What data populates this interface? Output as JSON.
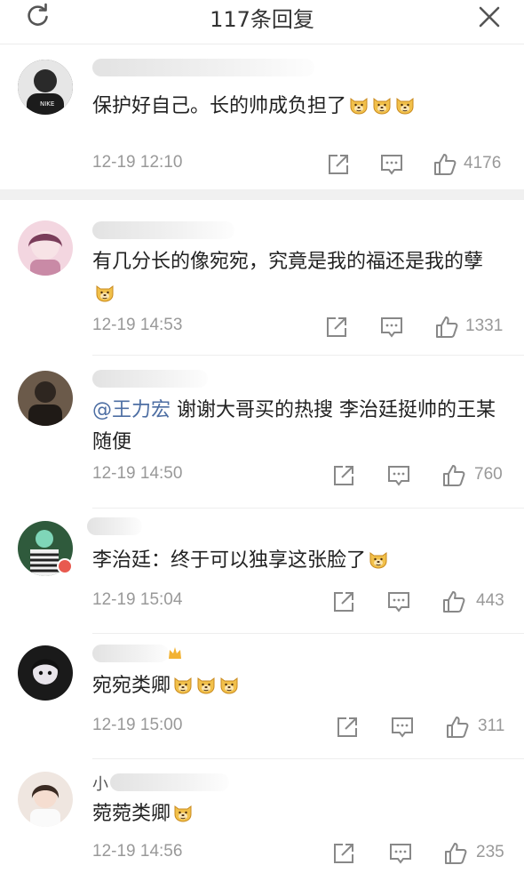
{
  "header": {
    "title": "117条回复",
    "refresh_icon": "refresh-icon",
    "close_icon": "close-icon"
  },
  "comments": [
    {
      "username": "",
      "text": "保护好自己。长的帅成负担了",
      "emoji_count": 3,
      "time": "12-19 12:10",
      "likes": "4176",
      "avatar_color": "#3a3a3a"
    },
    {
      "username": "",
      "text": "有几分长的像宛宛，究竟是我的福还是我的孽",
      "emoji_count": 1,
      "time": "12-19 14:53",
      "likes": "1331",
      "avatar_color": "#e8b9c8"
    },
    {
      "username": "",
      "mention": "@王力宏",
      "text": " 谢谢大哥买的热搜 李治廷挺帅的王某随便",
      "emoji_count": 0,
      "time": "12-19 14:50",
      "likes": "760",
      "avatar_color": "#4a4038"
    },
    {
      "username": "",
      "text": "李治廷：终于可以独享这张脸了",
      "emoji_count": 1,
      "time": "12-19 15:04",
      "likes": "443",
      "avatar_color": "#3a6a48"
    },
    {
      "username": "",
      "text": "宛宛类卿",
      "emoji_count": 3,
      "time": "12-19 15:00",
      "likes": "311",
      "avatar_color": "#2a2a2a"
    },
    {
      "username": "小",
      "text": "菀菀类卿",
      "emoji_count": 1,
      "time": "12-19 14:56",
      "likes": "235",
      "avatar_color": "#d8c2b4"
    }
  ],
  "colors": {
    "accent_link": "#4d6ea3",
    "meta_gray": "#999999",
    "divider": "#eeeeee"
  }
}
